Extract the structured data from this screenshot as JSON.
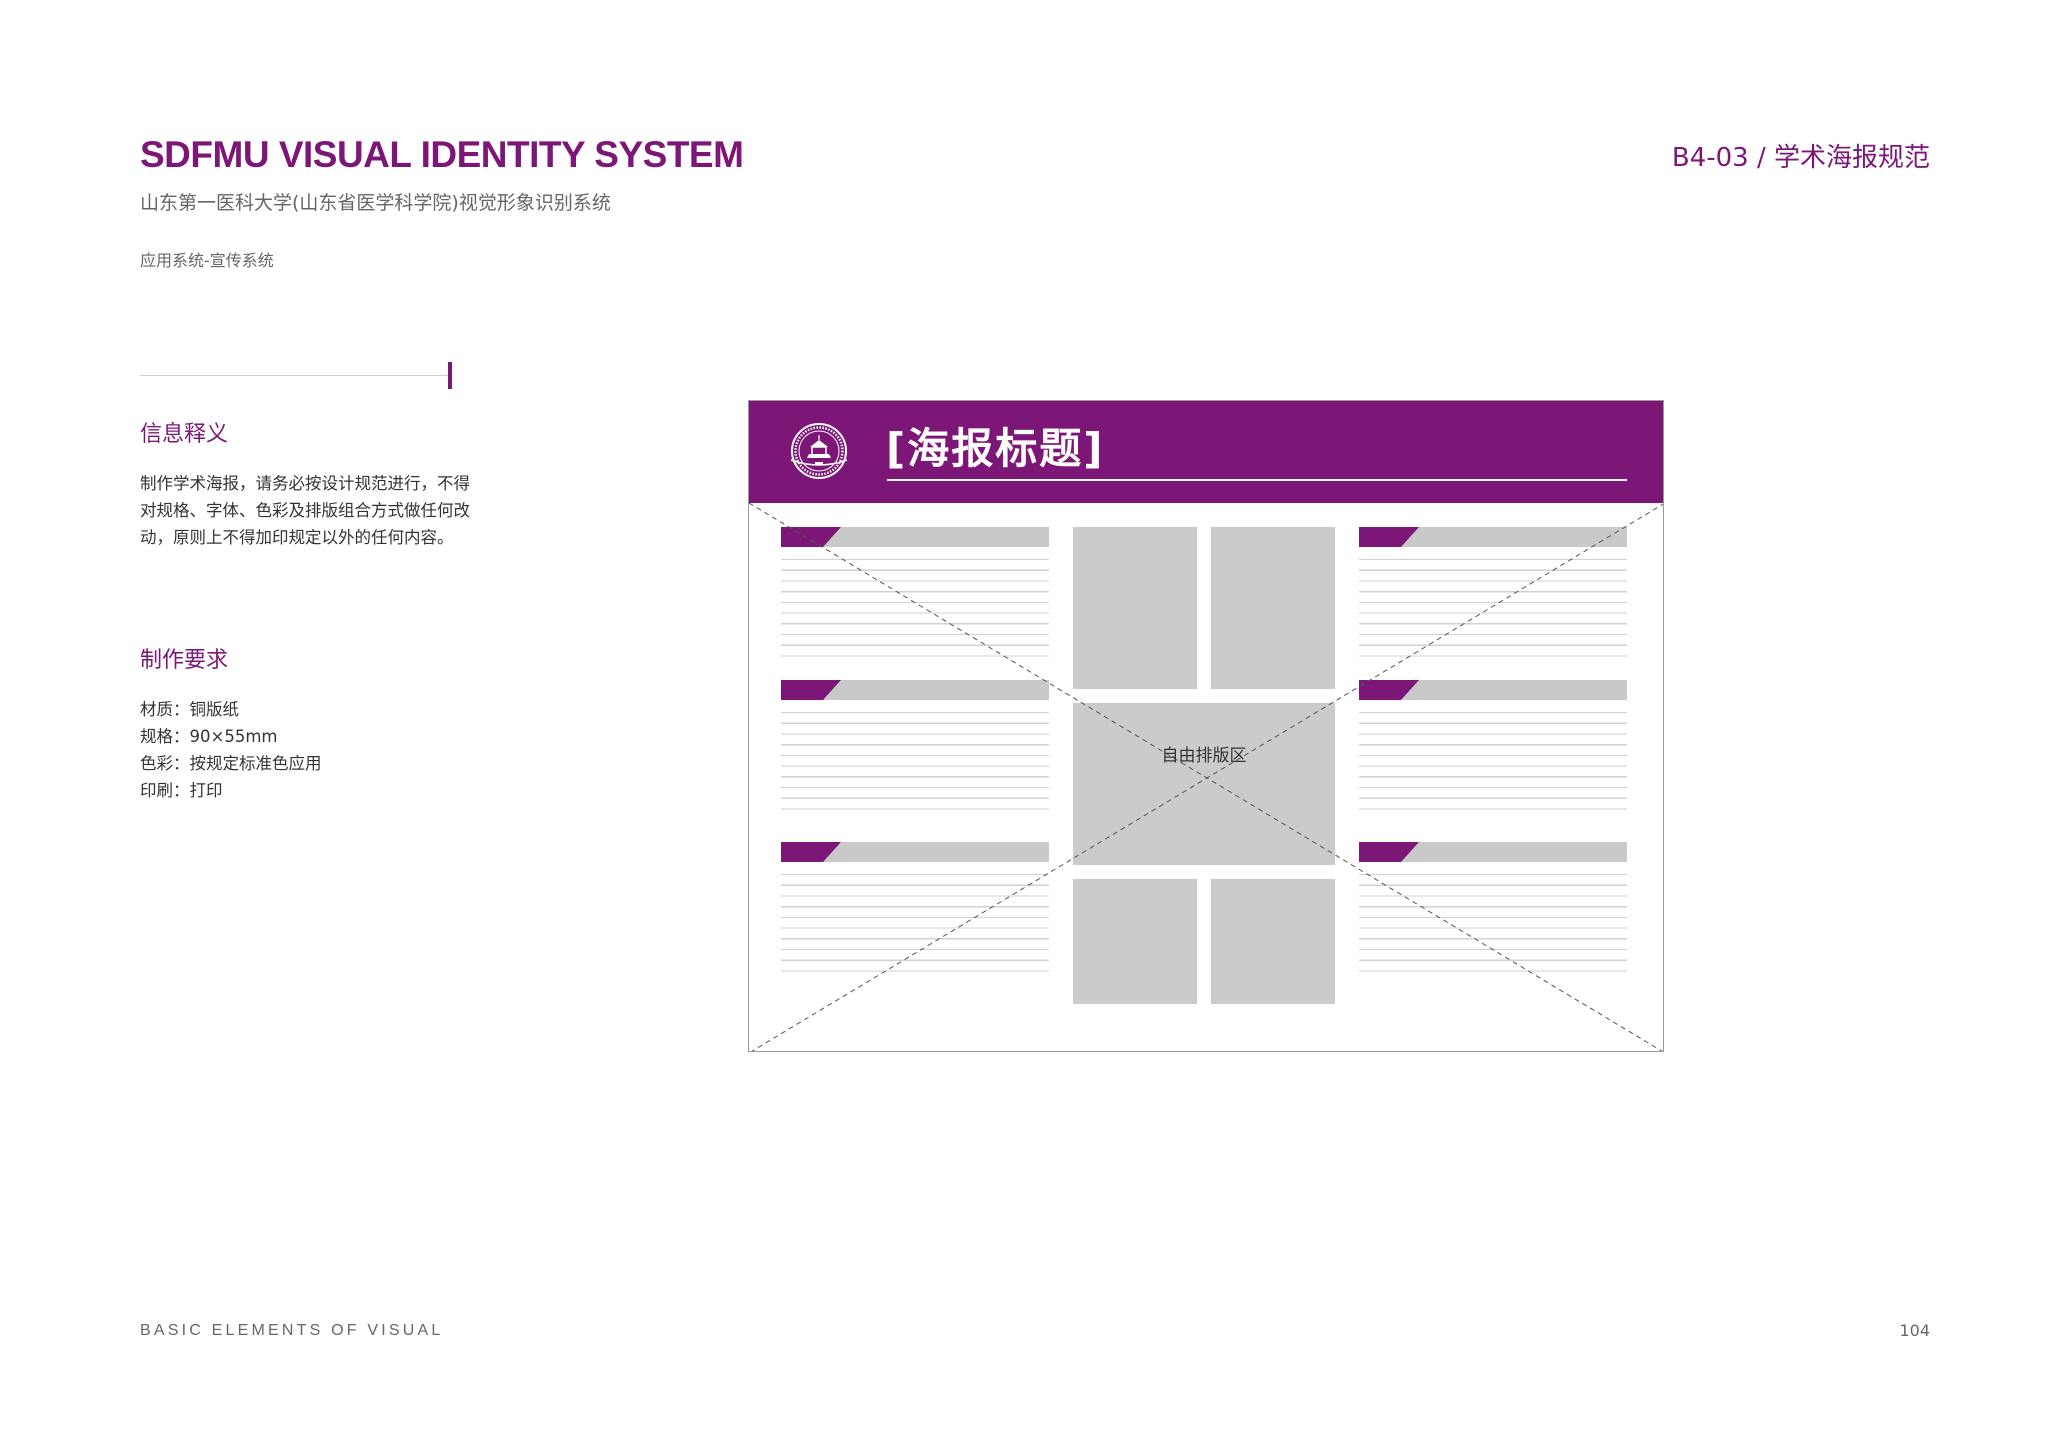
{
  "header": {
    "title": "SDFMU VISUAL IDENTITY SYSTEM",
    "subtitle": "山东第一医科大学(山东省医学科学院)视觉形象识别系统",
    "category": "应用系统-宣传系统",
    "page_code": "B4-03 / 学术海报规范"
  },
  "info": {
    "title": "信息释义",
    "body": "制作学术海报，请务必按设计规范进行，不得对规格、字体、色彩及排版组合方式做任何改动，原则上不得加印规定以外的任何内容。"
  },
  "requirements": {
    "title": "制作要求",
    "items": [
      "材质：铜版纸",
      "规格：90×55mm",
      "色彩：按规定标准色应用",
      "印刷：打印"
    ]
  },
  "poster": {
    "title": "[海报标题]",
    "free_area_label": "自由排版区",
    "seal_icon": "university-seal-icon",
    "colors": {
      "brand_purple": "#7d1777",
      "placeholder_gray": "#cbcbcb",
      "line_gray": "#d2d2d2"
    }
  },
  "footer": {
    "left": "BASIC ELEMENTS OF VISUAL",
    "page_number": "104"
  }
}
